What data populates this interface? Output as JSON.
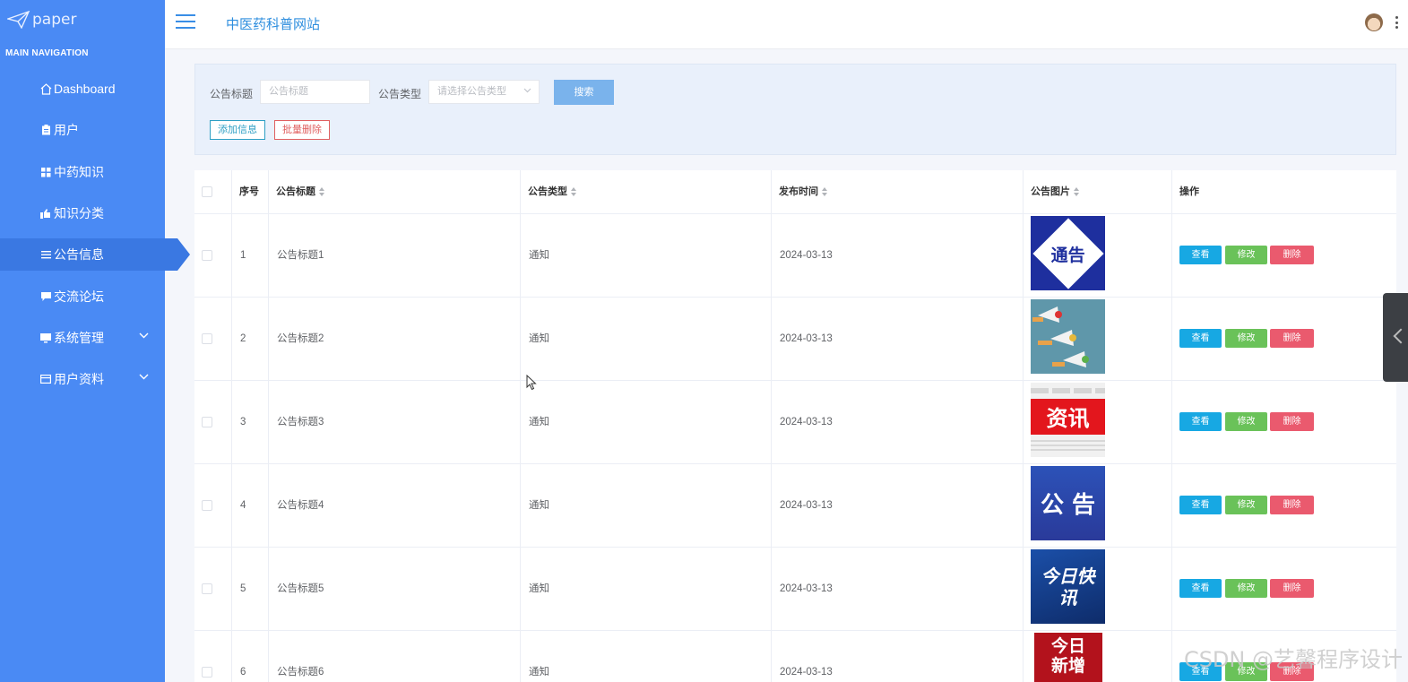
{
  "app": {
    "logo_text": "paper",
    "site_title": "中医药科普网站"
  },
  "sidebar": {
    "caption": "MAIN NAVIGATION",
    "items": [
      {
        "label": "Dashboard",
        "icon": "home-icon"
      },
      {
        "label": "用户",
        "icon": "clipboard-icon"
      },
      {
        "label": "中药知识",
        "icon": "grid-icon"
      },
      {
        "label": "知识分类",
        "icon": "thumb-icon"
      },
      {
        "label": "公告信息",
        "icon": "list-icon",
        "active": true
      },
      {
        "label": "交流论坛",
        "icon": "comment-icon"
      },
      {
        "label": "系统管理",
        "icon": "monitor-icon",
        "expandable": true
      },
      {
        "label": "用户资料",
        "icon": "card-icon",
        "expandable": true
      }
    ]
  },
  "search": {
    "title_label": "公告标题",
    "title_placeholder": "公告标题",
    "type_label": "公告类型",
    "type_placeholder": "请选择公告类型",
    "search_button": "搜索",
    "add_button": "添加信息",
    "batch_delete_button": "批量删除"
  },
  "table": {
    "columns": [
      "序号",
      "公告标题",
      "公告类型",
      "发布时间",
      "公告图片",
      "操作"
    ],
    "actions": {
      "view": "查看",
      "edit": "修改",
      "delete": "删除"
    },
    "rows": [
      {
        "index": "1",
        "title": "公告标题1",
        "type": "通知",
        "date": "2024-03-13",
        "image_text": "通告"
      },
      {
        "index": "2",
        "title": "公告标题2",
        "type": "通知",
        "date": "2024-03-13",
        "image_text": ""
      },
      {
        "index": "3",
        "title": "公告标题3",
        "type": "通知",
        "date": "2024-03-13",
        "image_text": "资讯"
      },
      {
        "index": "4",
        "title": "公告标题4",
        "type": "通知",
        "date": "2024-03-13",
        "image_text": "公 告"
      },
      {
        "index": "5",
        "title": "公告标题5",
        "type": "通知",
        "date": "2024-03-13",
        "image_text": "今日快讯"
      },
      {
        "index": "6",
        "title": "公告标题6",
        "type": "通知",
        "date": "2024-03-13",
        "image_text": "今日新增"
      }
    ]
  },
  "watermark": "CSDN @艺馨程序设计",
  "colors": {
    "sidebar": "#4a8af4",
    "sidebar_active": "#3a78e2",
    "view_button": "#17a8e3",
    "edit_button": "#6ac259",
    "delete_button": "#ea5a6e"
  }
}
